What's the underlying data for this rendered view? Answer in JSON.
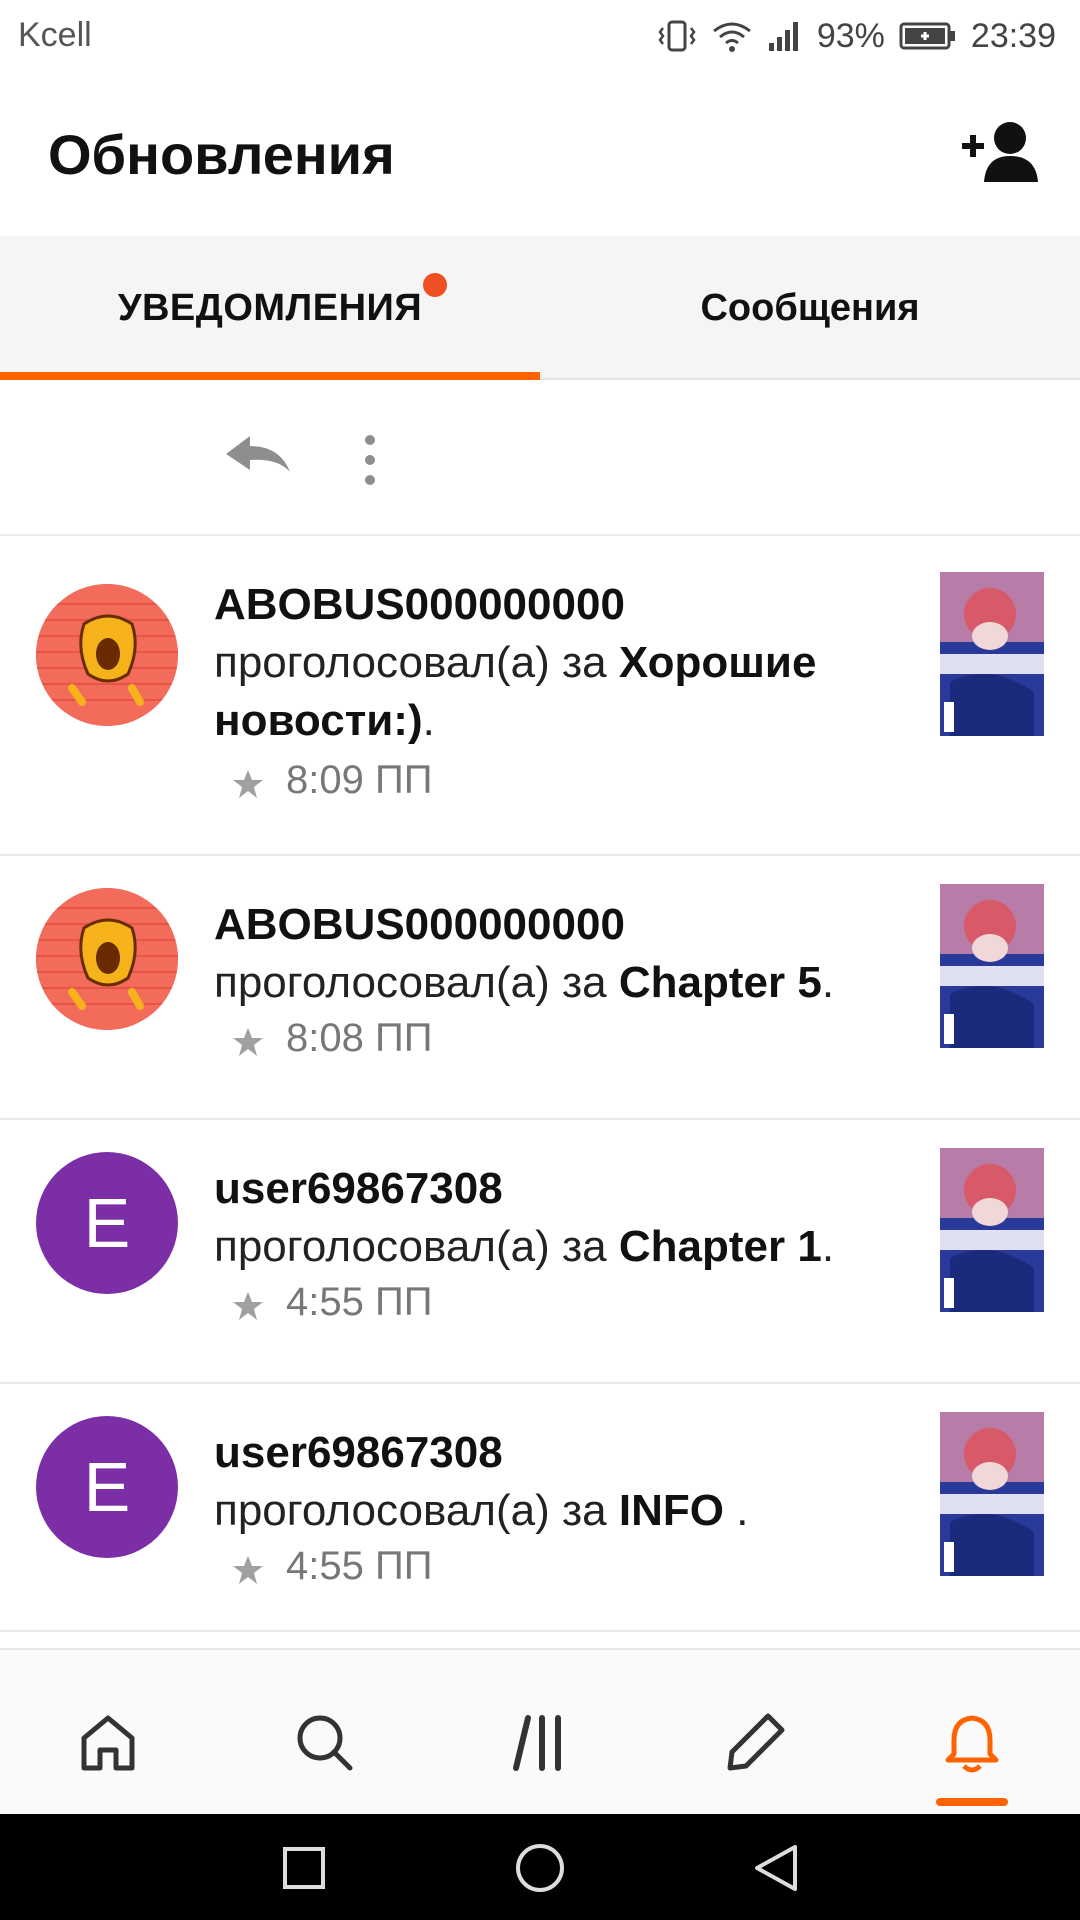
{
  "status_bar": {
    "carrier": "Kcell",
    "battery_percent": "93%",
    "time": "23:39",
    "icons": [
      "vibrate-icon",
      "wifi-icon",
      "signal-icon",
      "battery-icon"
    ]
  },
  "header": {
    "title": "Обновления",
    "add_user_icon": "add-user-icon"
  },
  "tabs": [
    {
      "label": "УВЕДОМЛЕНИЯ",
      "active": true,
      "has_badge_dot": true
    },
    {
      "label": "Сообщения",
      "active": false
    }
  ],
  "colors": {
    "accent": "#ff6200",
    "badge_dot": "#f04e23",
    "avatar_letter_bg": "#7b2ea6"
  },
  "notifications": [
    {
      "username": "ABOBUS000000000",
      "action": "проголосовал(а) за ",
      "target": "Хорошие новости:)",
      "suffix": ".",
      "time": "8:09 ПП",
      "avatar_type": "art"
    },
    {
      "username": "ABOBUS000000000",
      "action": "проголосовал(а) за ",
      "target": "Chapter 5",
      "suffix": ".",
      "time": "8:08 ПП",
      "avatar_type": "art"
    },
    {
      "username": "user69867308",
      "action": "проголосовал(а) за ",
      "target": "Chapter 1",
      "suffix": ".",
      "time": "4:55 ПП",
      "avatar_type": "letter",
      "avatar_letter": "E"
    },
    {
      "username": "user69867308",
      "action": "проголосовал(а) за ",
      "target": "INFO ",
      "suffix": ".",
      "time": "4:55 ПП",
      "avatar_type": "letter",
      "avatar_letter": "E"
    }
  ],
  "bottom_nav": [
    {
      "icon": "home-icon",
      "active": false
    },
    {
      "icon": "search-icon",
      "active": false
    },
    {
      "icon": "library-icon",
      "active": false
    },
    {
      "icon": "pencil-icon",
      "active": false
    },
    {
      "icon": "bell-icon",
      "active": true
    }
  ],
  "system_nav": [
    "recent-apps-icon",
    "home-circle-icon",
    "back-triangle-icon"
  ]
}
